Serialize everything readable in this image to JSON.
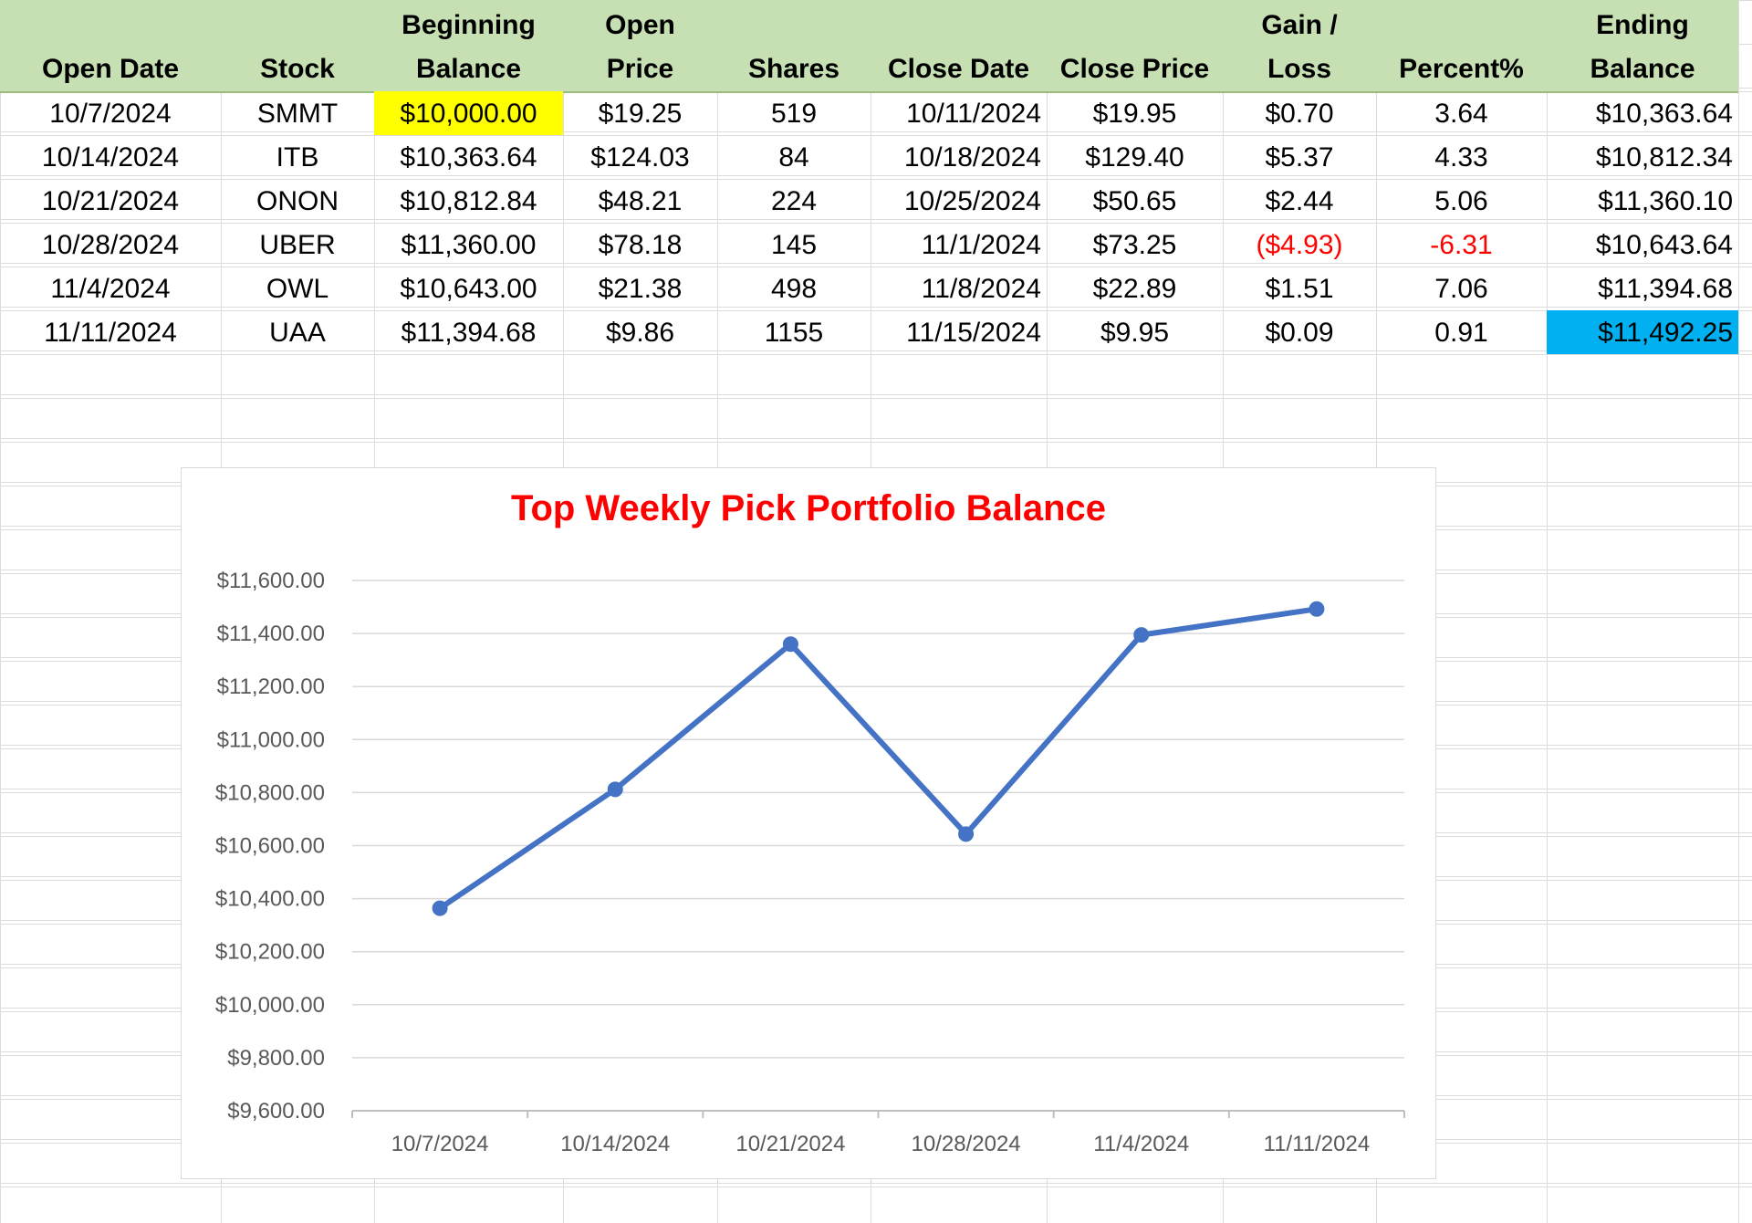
{
  "table": {
    "headers": [
      {
        "line1": "",
        "line2": "Open Date"
      },
      {
        "line1": "",
        "line2": "Stock"
      },
      {
        "line1": "Beginning",
        "line2": "Balance"
      },
      {
        "line1": "Open",
        "line2": "Price"
      },
      {
        "line1": "",
        "line2": "Shares"
      },
      {
        "line1": "",
        "line2": "Close Date"
      },
      {
        "line1": "",
        "line2": "Close Price"
      },
      {
        "line1": "Gain /",
        "line2": "Loss"
      },
      {
        "line1": "",
        "line2": "Percent%"
      },
      {
        "line1": "Ending",
        "line2": "Balance"
      }
    ],
    "rows": [
      {
        "open_date": "10/7/2024",
        "stock": "SMMT",
        "beginning_balance": "$10,000.00",
        "open_price": "$19.25",
        "shares": "519",
        "close_date": "10/11/2024",
        "close_price": "$19.95",
        "gain_loss": "$0.70",
        "percent": "3.64",
        "ending_balance": "$10,363.64"
      },
      {
        "open_date": "10/14/2024",
        "stock": "ITB",
        "beginning_balance": "$10,363.64",
        "open_price": "$124.03",
        "shares": "84",
        "close_date": "10/18/2024",
        "close_price": "$129.40",
        "gain_loss": "$5.37",
        "percent": "4.33",
        "ending_balance": "$10,812.34"
      },
      {
        "open_date": "10/21/2024",
        "stock": "ONON",
        "beginning_balance": "$10,812.84",
        "open_price": "$48.21",
        "shares": "224",
        "close_date": "10/25/2024",
        "close_price": "$50.65",
        "gain_loss": "$2.44",
        "percent": "5.06",
        "ending_balance": "$11,360.10"
      },
      {
        "open_date": "10/28/2024",
        "stock": "UBER",
        "beginning_balance": "$11,360.00",
        "open_price": "$78.18",
        "shares": "145",
        "close_date": "11/1/2024",
        "close_price": "$73.25",
        "gain_loss": "($4.93)",
        "percent": "-6.31",
        "ending_balance": "$10,643.64"
      },
      {
        "open_date": "11/4/2024",
        "stock": "OWL",
        "beginning_balance": "$10,643.00",
        "open_price": "$21.38",
        "shares": "498",
        "close_date": "11/8/2024",
        "close_price": "$22.89",
        "gain_loss": "$1.51",
        "percent": "7.06",
        "ending_balance": "$11,394.68"
      },
      {
        "open_date": "11/11/2024",
        "stock": "UAA",
        "beginning_balance": "$11,394.68",
        "open_price": "$9.86",
        "shares": "1155",
        "close_date": "11/15/2024",
        "close_price": "$9.95",
        "gain_loss": "$0.09",
        "percent": "0.91",
        "ending_balance": "$11,492.25"
      }
    ]
  },
  "colors": {
    "header_fill": "#c6e0b4",
    "highlight_yellow": "#ffff00",
    "highlight_blue": "#00b0f0",
    "negative_text": "#ff0000",
    "series_line": "#4472c4",
    "chart_title": "#ff0000"
  },
  "chart_data": {
    "type": "line",
    "title": "Top Weekly Pick Portfolio Balance",
    "xlabel": "",
    "ylabel": "",
    "categories": [
      "10/7/2024",
      "10/14/2024",
      "10/21/2024",
      "10/28/2024",
      "11/4/2024",
      "11/11/2024"
    ],
    "series": [
      {
        "values": [
          10363.64,
          10812.34,
          11360.1,
          10643.64,
          11394.68,
          11492.25
        ]
      }
    ],
    "ylim": [
      9600,
      11600
    ],
    "ytick_step": 200,
    "ytick_labels": [
      "$11,600.00",
      "$11,400.00",
      "$11,200.00",
      "$11,000.00",
      "$10,800.00",
      "$10,600.00",
      "$10,400.00",
      "$10,200.00",
      "$10,000.00",
      "$9,800.00",
      "$9,600.00"
    ],
    "grid": true,
    "legend": "none",
    "markers": true
  }
}
